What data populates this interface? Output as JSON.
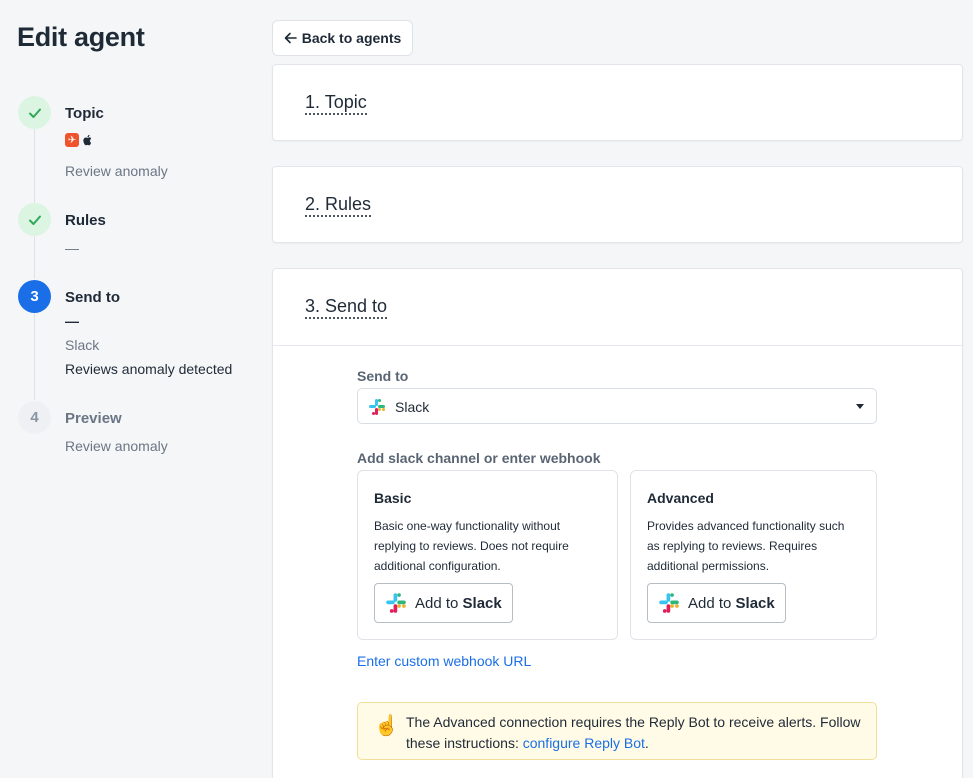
{
  "page": {
    "title": "Edit agent"
  },
  "stepper": {
    "steps": [
      {
        "number": "1",
        "title": "Topic",
        "state": "done",
        "sub": "Review anomaly"
      },
      {
        "number": "2",
        "title": "Rules",
        "state": "done",
        "dash": "—"
      },
      {
        "number": "3",
        "title": "Send to",
        "state": "active",
        "dash": "—",
        "channel": "Slack",
        "event": "Reviews anomaly detected"
      },
      {
        "number": "4",
        "title": "Preview",
        "state": "todo",
        "sub": "Review anomaly"
      }
    ]
  },
  "back_button": {
    "label": "Back to agents",
    "icon": "arrow-left-icon"
  },
  "sections": {
    "topic": {
      "title": "1. Topic"
    },
    "rules": {
      "title": "2. Rules"
    },
    "send_to": {
      "title": "3. Send to",
      "field_label": "Send to",
      "select_value": "Slack",
      "channel_label": "Add slack channel or enter webhook",
      "basic": {
        "title": "Basic",
        "description": "Basic one-way functionality without replying to reviews. Does not require additional configuration.",
        "button_prefix": "Add to ",
        "button_brand": "Slack"
      },
      "advanced": {
        "title": "Advanced",
        "description": "Provides advanced functionality such as replying to reviews. Requires additional permissions.",
        "button_prefix": "Add to ",
        "button_brand": "Slack"
      },
      "webhook_link": "Enter custom webhook URL",
      "notice": {
        "icon": "pointing-finger-icon",
        "text": "The Advanced connection requires the Reply Bot to receive alerts. Follow these instructions: ",
        "link": "configure Reply Bot",
        "suffix": "."
      }
    }
  },
  "colors": {
    "primary": "#1a6fe8",
    "done_bg": "#dcf5e3",
    "done_check": "#2fa85a",
    "notice_bg": "#fffbe6",
    "notice_border": "#f1df98"
  }
}
